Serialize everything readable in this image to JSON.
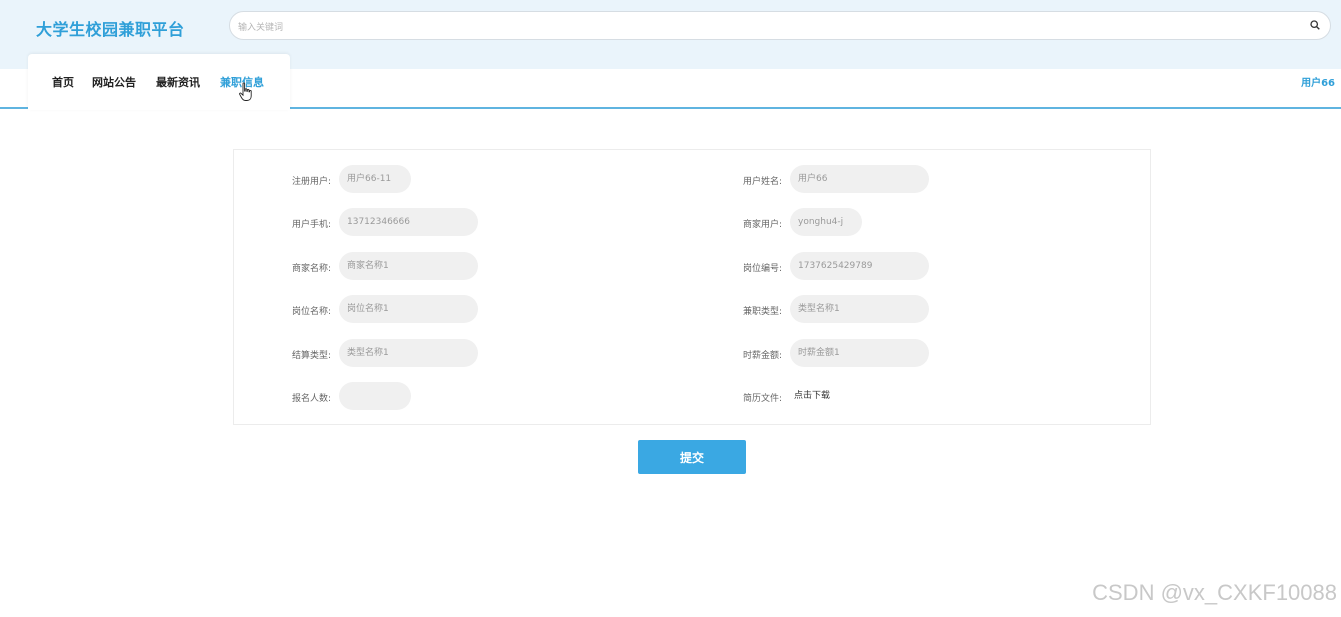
{
  "header": {
    "logo": "大学生校园兼职平台",
    "search_placeholder": "输入关键词"
  },
  "nav": {
    "items": [
      "首页",
      "网站公告",
      "最新资讯",
      "兼职信息"
    ],
    "active_index": 3,
    "user": "用户66"
  },
  "form": {
    "left": [
      {
        "label": "注册用户:",
        "value": "用户66-11"
      },
      {
        "label": "用户手机:",
        "value": "13712346666"
      },
      {
        "label": "商家名称:",
        "value": "商家名称1"
      },
      {
        "label": "岗位名称:",
        "value": "岗位名称1"
      },
      {
        "label": "结算类型:",
        "value": "类型名称1"
      },
      {
        "label": "报名人数:",
        "value": ""
      }
    ],
    "right": [
      {
        "label": "用户姓名:",
        "value": "用户66"
      },
      {
        "label": "商家用户:",
        "value": "yonghu4-j"
      },
      {
        "label": "岗位编号:",
        "value": "1737625429789"
      },
      {
        "label": "兼职类型:",
        "value": "类型名称1"
      },
      {
        "label": "时薪金额:",
        "value": "时薪金额1"
      },
      {
        "label": "简历文件:",
        "value": "点击下载"
      }
    ],
    "submit_label": "提交"
  },
  "watermark": "CSDN @vx_CXKF10088",
  "colors": {
    "accent": "#2f9fd8",
    "button": "#3aa8e3",
    "band": "#eaf4fb"
  }
}
